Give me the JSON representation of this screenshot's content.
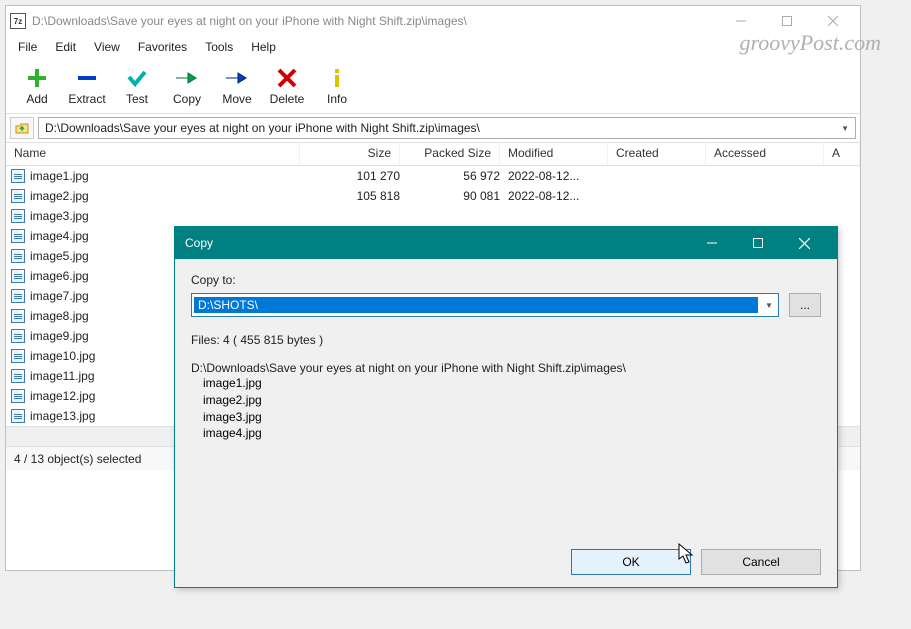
{
  "window": {
    "app_glyph": "7z",
    "title": "D:\\Downloads\\Save your eyes at night on your iPhone with Night Shift.zip\\images\\"
  },
  "menu": {
    "items": [
      "File",
      "Edit",
      "View",
      "Favorites",
      "Tools",
      "Help"
    ]
  },
  "toolbar": {
    "add": "Add",
    "extract": "Extract",
    "test": "Test",
    "copy": "Copy",
    "move": "Move",
    "delete": "Delete",
    "info": "Info"
  },
  "path": {
    "value": "D:\\Downloads\\Save your eyes at night on your iPhone with Night Shift.zip\\images\\"
  },
  "columns": {
    "name": "Name",
    "size": "Size",
    "packed": "Packed Size",
    "modified": "Modified",
    "created": "Created",
    "accessed": "Accessed",
    "last": "A"
  },
  "files": [
    {
      "name": "image1.jpg",
      "size": "101 270",
      "packed": "56 972",
      "modified": "2022-08-12..."
    },
    {
      "name": "image2.jpg",
      "size": "105 818",
      "packed": "90 081",
      "modified": "2022-08-12..."
    },
    {
      "name": "image3.jpg",
      "size": "",
      "packed": "",
      "modified": ""
    },
    {
      "name": "image4.jpg",
      "size": "",
      "packed": "",
      "modified": ""
    },
    {
      "name": "image5.jpg",
      "size": "",
      "packed": "",
      "modified": ""
    },
    {
      "name": "image6.jpg",
      "size": "",
      "packed": "",
      "modified": ""
    },
    {
      "name": "image7.jpg",
      "size": "",
      "packed": "",
      "modified": ""
    },
    {
      "name": "image8.jpg",
      "size": "",
      "packed": "",
      "modified": ""
    },
    {
      "name": "image9.jpg",
      "size": "",
      "packed": "",
      "modified": ""
    },
    {
      "name": "image10.jpg",
      "size": "",
      "packed": "",
      "modified": ""
    },
    {
      "name": "image11.jpg",
      "size": "",
      "packed": "",
      "modified": ""
    },
    {
      "name": "image12.jpg",
      "size": "",
      "packed": "",
      "modified": ""
    },
    {
      "name": "image13.jpg",
      "size": "",
      "packed": "",
      "modified": ""
    }
  ],
  "status": "4 / 13 object(s) selected",
  "dialog": {
    "title": "Copy",
    "copy_to_label": "Copy to:",
    "dest": "D:\\SHOTS\\",
    "browse": "...",
    "summary": "Files: 4   ( 455 815 bytes )",
    "source": "D:\\Downloads\\Save your eyes at night on your iPhone with Night Shift.zip\\images\\",
    "items": [
      "image1.jpg",
      "image2.jpg",
      "image3.jpg",
      "image4.jpg"
    ],
    "ok": "OK",
    "cancel": "Cancel"
  },
  "watermark": "groovyPost.com"
}
